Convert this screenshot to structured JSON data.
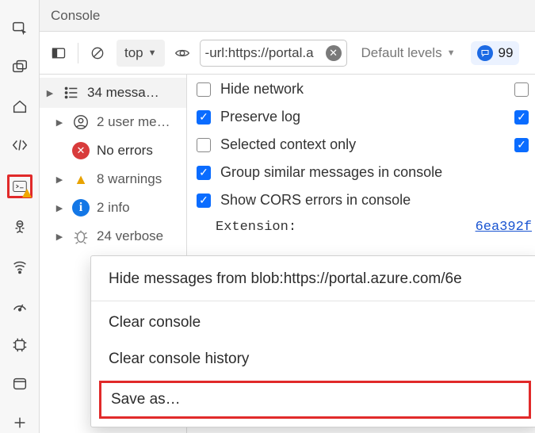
{
  "tab": {
    "title": "Console"
  },
  "toolbar": {
    "context_label": "top",
    "filter_text": "-url:https://portal.a",
    "levels_label": "Default levels",
    "issue_count": "99"
  },
  "groups": {
    "messages": "34 messa…",
    "user": "2 user me…",
    "errors": "No errors",
    "warnings": "8 warnings",
    "info": "2 info",
    "verbose": "24 verbose"
  },
  "settings": {
    "hide_network": "Hide network",
    "preserve_log": "Preserve log",
    "selected_only": "Selected context only",
    "group_similar": "Group similar messages in console",
    "show_cors": "Show CORS errors in console"
  },
  "extension": {
    "label": "Extension:",
    "link": "6ea392f"
  },
  "menu": {
    "hide_from": "Hide messages from blob:https://portal.azure.com/6e",
    "clear_console": "Clear console",
    "clear_history": "Clear console history",
    "save_as": "Save as…"
  }
}
